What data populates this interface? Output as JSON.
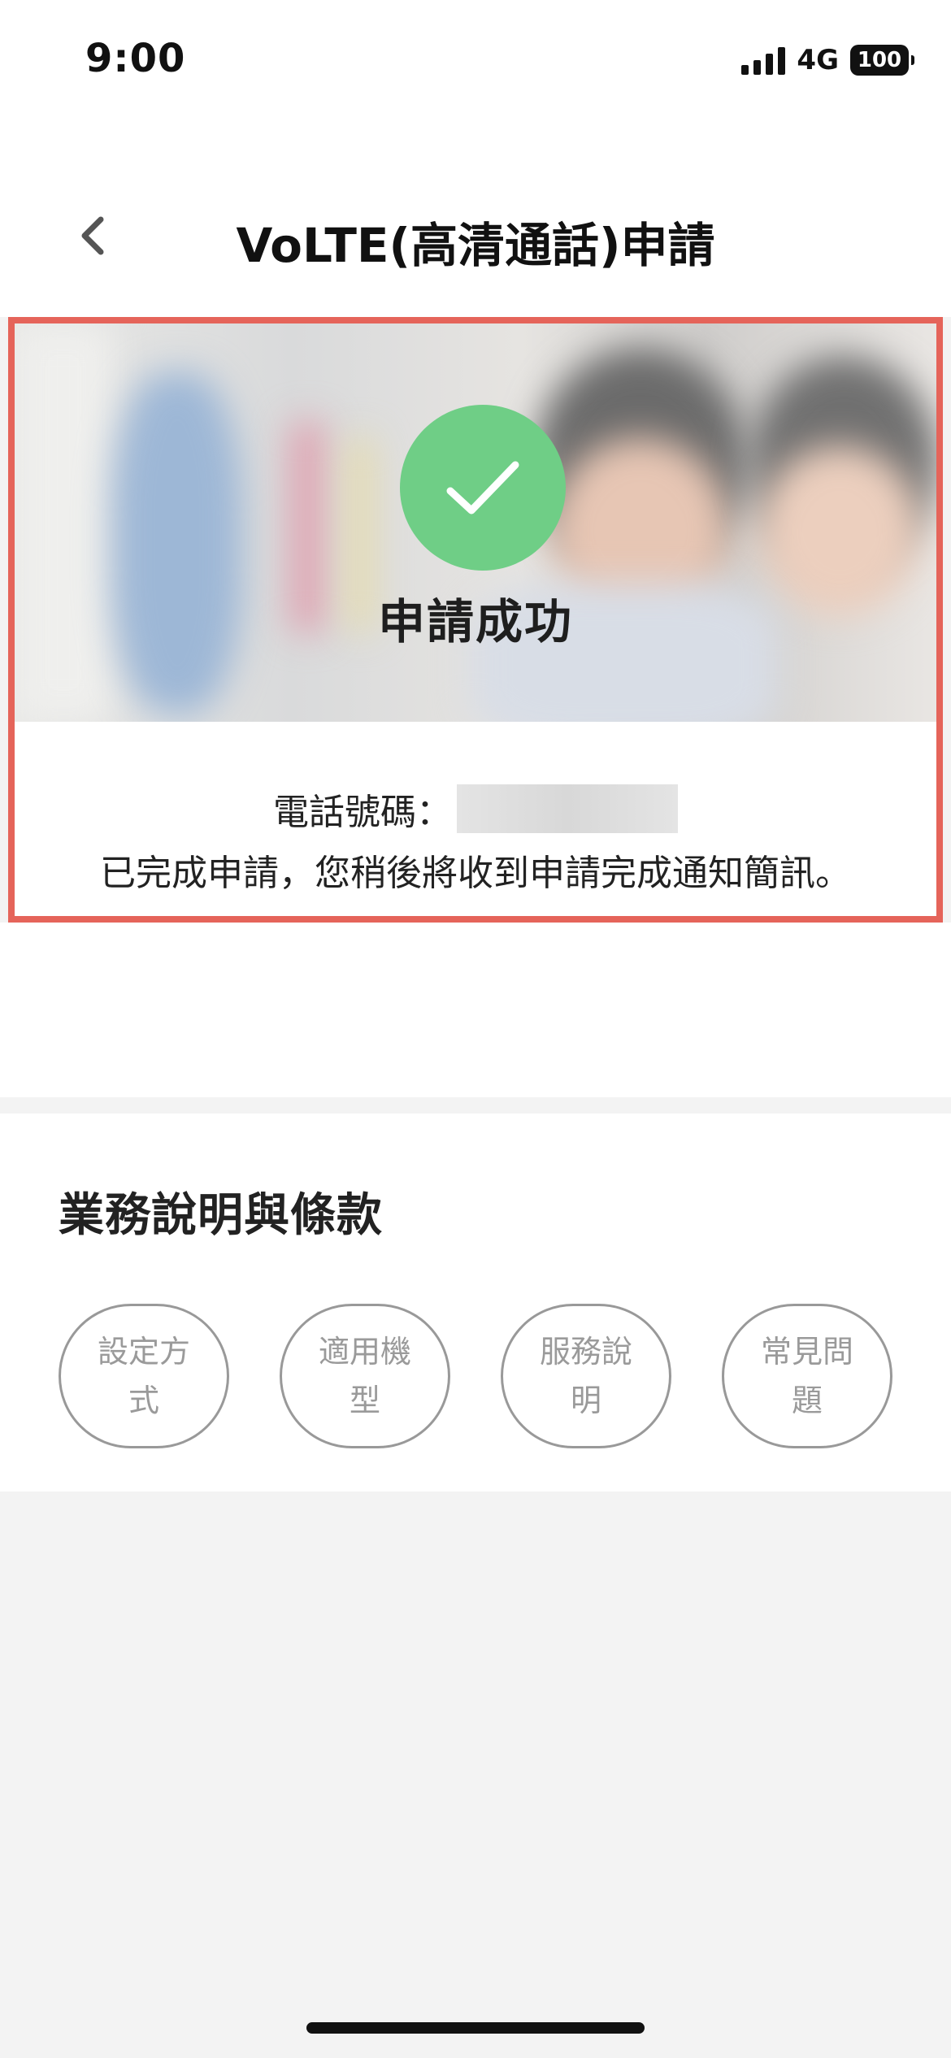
{
  "status_bar": {
    "time": "9:00",
    "network": "4G",
    "battery": "100",
    "signal_icon": "signal-bars-icon",
    "battery_icon": "battery-icon"
  },
  "header": {
    "title": "VoLTE(高清通話)申請",
    "back_icon": "chevron-left-icon"
  },
  "success_card": {
    "status_icon": "checkmark-icon",
    "status_color": "#6fce86",
    "highlight_color": "#e5645a",
    "status_text": "申請成功",
    "phone_label": "電話號碼：",
    "message": "已完成申請，您稍後將收到申請完成通知簡訊。"
  },
  "terms": {
    "title": "業務說明與條款",
    "buttons": [
      {
        "label": "設定方式"
      },
      {
        "label": "適用機型"
      },
      {
        "label": "服務說明"
      },
      {
        "label": "常見問題"
      }
    ]
  }
}
